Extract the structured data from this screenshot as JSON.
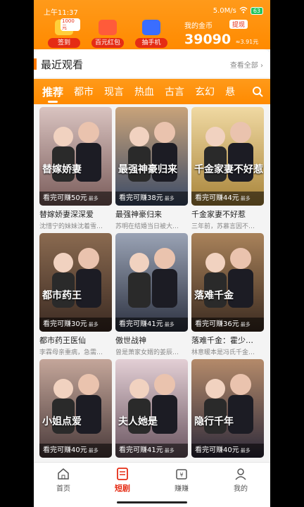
{
  "status": {
    "time": "上午11:37",
    "network": "5.0M/s",
    "battery": "63"
  },
  "rewards": [
    {
      "label": "签到",
      "tag": "1000元",
      "color": "#ffcf3a"
    },
    {
      "label": "百元红包",
      "tag": "",
      "color": "#ff5b3a"
    },
    {
      "label": "抽手机",
      "tag": "",
      "color": "#3a6dff"
    }
  ],
  "coins": {
    "label": "我的金币",
    "withdraw": "提现",
    "amount": "39090",
    "rmb": "≈3.91元"
  },
  "recent": {
    "title": "最近观看",
    "more": "查看全部"
  },
  "tabs": [
    "推荐",
    "都市",
    "现言",
    "热血",
    "古言",
    "玄幻",
    "悬"
  ],
  "cards": [
    {
      "cover_title": "替嫁娇妻",
      "earn": "看完可赚50元",
      "most": "最多",
      "name": "替嫁娇妻深深爱",
      "desc": "沈惜宁的妹妹沈着雪…",
      "c1": "#7a5c5a",
      "c2": "#d9c3c0"
    },
    {
      "cover_title": "最强神豪归来",
      "earn": "看完可赚38元",
      "most": "最多",
      "name": "最强神豪归来",
      "desc": "苏明在结婚当日被大…",
      "c1": "#3a4a66",
      "c2": "#c9a37a"
    },
    {
      "cover_title": "千金家妻不好惹",
      "earn": "看完可赚44元",
      "most": "最多",
      "name": "千金家妻不好惹",
      "desc": "三年前，苏慕言因不…",
      "c1": "#a8843a",
      "c2": "#f0d9a2"
    },
    {
      "cover_title": "都市药王",
      "earn": "看完可赚30元",
      "most": "最多",
      "name": "都市药王医仙",
      "desc": "李霖母亲重病，急需…",
      "c1": "#3b2a22",
      "c2": "#8a6a50"
    },
    {
      "cover_title": "",
      "earn": "看完可赚41元",
      "most": "最多",
      "name": "傲世战神",
      "desc": "曾是萧家女婿的姜辰…",
      "c1": "#2c3140",
      "c2": "#9aa3b5"
    },
    {
      "cover_title": "落难千金",
      "earn": "看完可赚36元",
      "most": "最多",
      "name": "落难千金：霍少…",
      "desc": "林意暖本是冯氏千金…",
      "c1": "#3a2a20",
      "c2": "#a9825a"
    },
    {
      "cover_title": "小姐点爱",
      "earn": "看完可赚40元",
      "most": "最多",
      "name": "",
      "desc": "",
      "c1": "#4a3a3a",
      "c2": "#c4a69a"
    },
    {
      "cover_title": "夫人她是",
      "earn": "看完可赚41元",
      "most": "最多",
      "name": "",
      "desc": "",
      "c1": "#6a5560",
      "c2": "#e3cfd5"
    },
    {
      "cover_title": "隐行千年",
      "earn": "看完可赚40元",
      "most": "最多",
      "name": "",
      "desc": "",
      "c1": "#2e2a3a",
      "c2": "#b48a6a"
    }
  ],
  "nav": [
    {
      "label": "首页",
      "icon": "home-icon",
      "active": false
    },
    {
      "label": "短剧",
      "icon": "drama-icon",
      "active": true
    },
    {
      "label": "赚赚",
      "icon": "earn-icon",
      "active": false
    },
    {
      "label": "我的",
      "icon": "profile-icon",
      "active": false
    }
  ],
  "colors": {
    "accent": "#ff8a00",
    "red": "#e52c14"
  }
}
